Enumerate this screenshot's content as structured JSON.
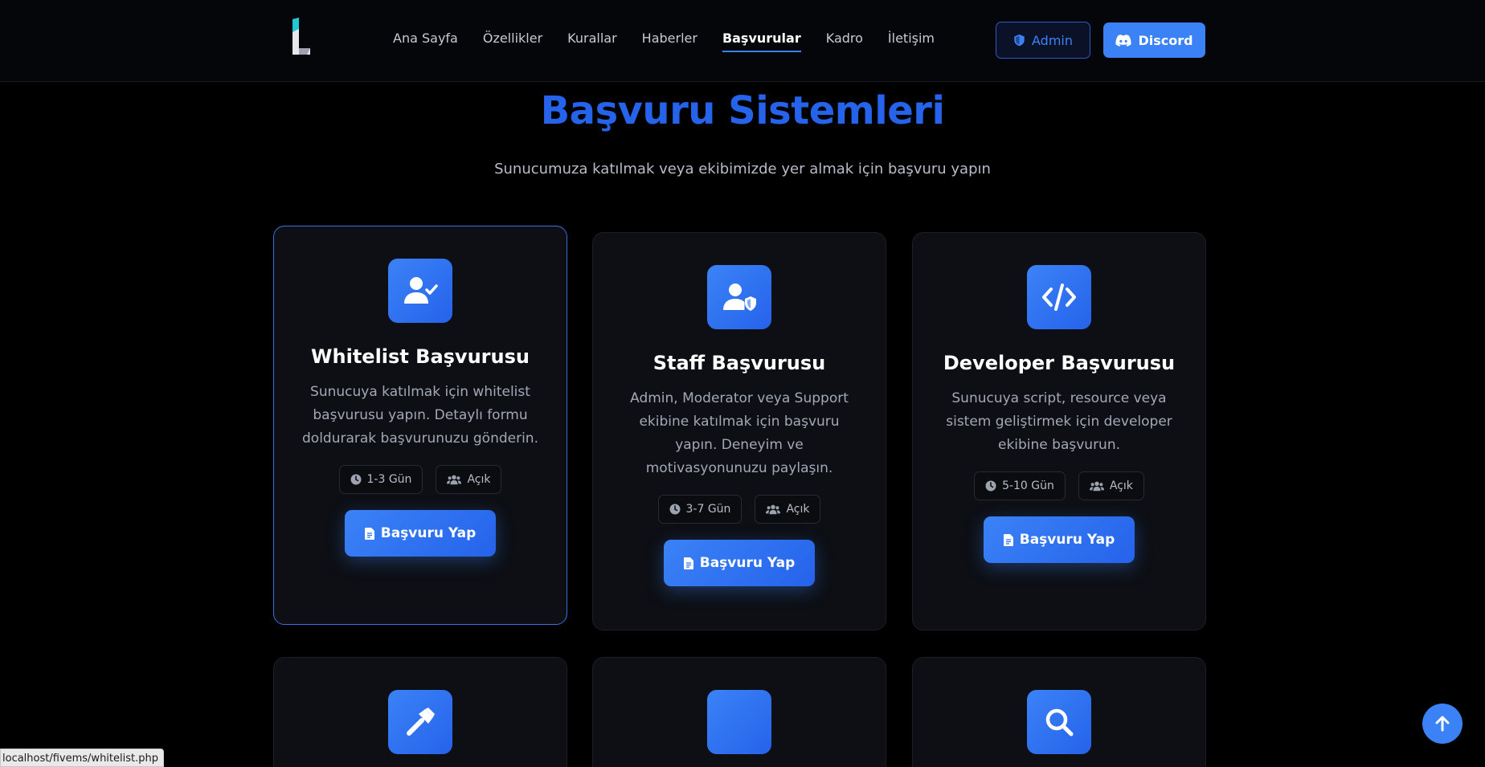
{
  "colors": {
    "accent": "#3b82f6",
    "title": "#2563eb",
    "background": "#000000",
    "card": "#0d0f14"
  },
  "nav": {
    "links": [
      {
        "label": "Ana Sayfa",
        "active": false
      },
      {
        "label": "Özellikler",
        "active": false
      },
      {
        "label": "Kurallar",
        "active": false
      },
      {
        "label": "Haberler",
        "active": false
      },
      {
        "label": "Başvurular",
        "active": true
      },
      {
        "label": "Kadro",
        "active": false
      },
      {
        "label": "İletişim",
        "active": false
      }
    ],
    "admin_label": "Admin",
    "discord_label": "Discord"
  },
  "hero": {
    "title": "Başvuru Sistemleri",
    "subtitle": "Sunucumuza katılmak veya ekibimizde yer almak için başvuru yapın"
  },
  "cards": [
    {
      "icon": "user-check-icon",
      "title": "Whitelist Başvurusu",
      "description": "Sunucuya katılmak için whitelist başvurusu yapın. Detaylı formu doldurarak başvurunuzu gönderin.",
      "duration": "1-3 Gün",
      "status": "Açık",
      "button": "Başvuru Yap"
    },
    {
      "icon": "user-shield-icon",
      "title": "Staff Başvurusu",
      "description": "Admin, Moderator veya Support ekibine katılmak için başvuru yapın. Deneyim ve motivasyonunuzu paylaşın.",
      "duration": "3-7 Gün",
      "status": "Açık",
      "button": "Başvuru Yap"
    },
    {
      "icon": "code-icon",
      "title": "Developer Başvurusu",
      "description": "Sunucuya script, resource veya sistem geliştirmek için developer ekibine başvurun.",
      "duration": "5-10 Gün",
      "status": "Açık",
      "button": "Başvuru Yap"
    }
  ],
  "lower_cards": [
    {
      "icon": "hammer-icon"
    },
    {
      "icon": "blank-icon"
    },
    {
      "icon": "search-icon"
    }
  ],
  "status_bar": {
    "url": "localhost/fivems/whitelist.php"
  }
}
